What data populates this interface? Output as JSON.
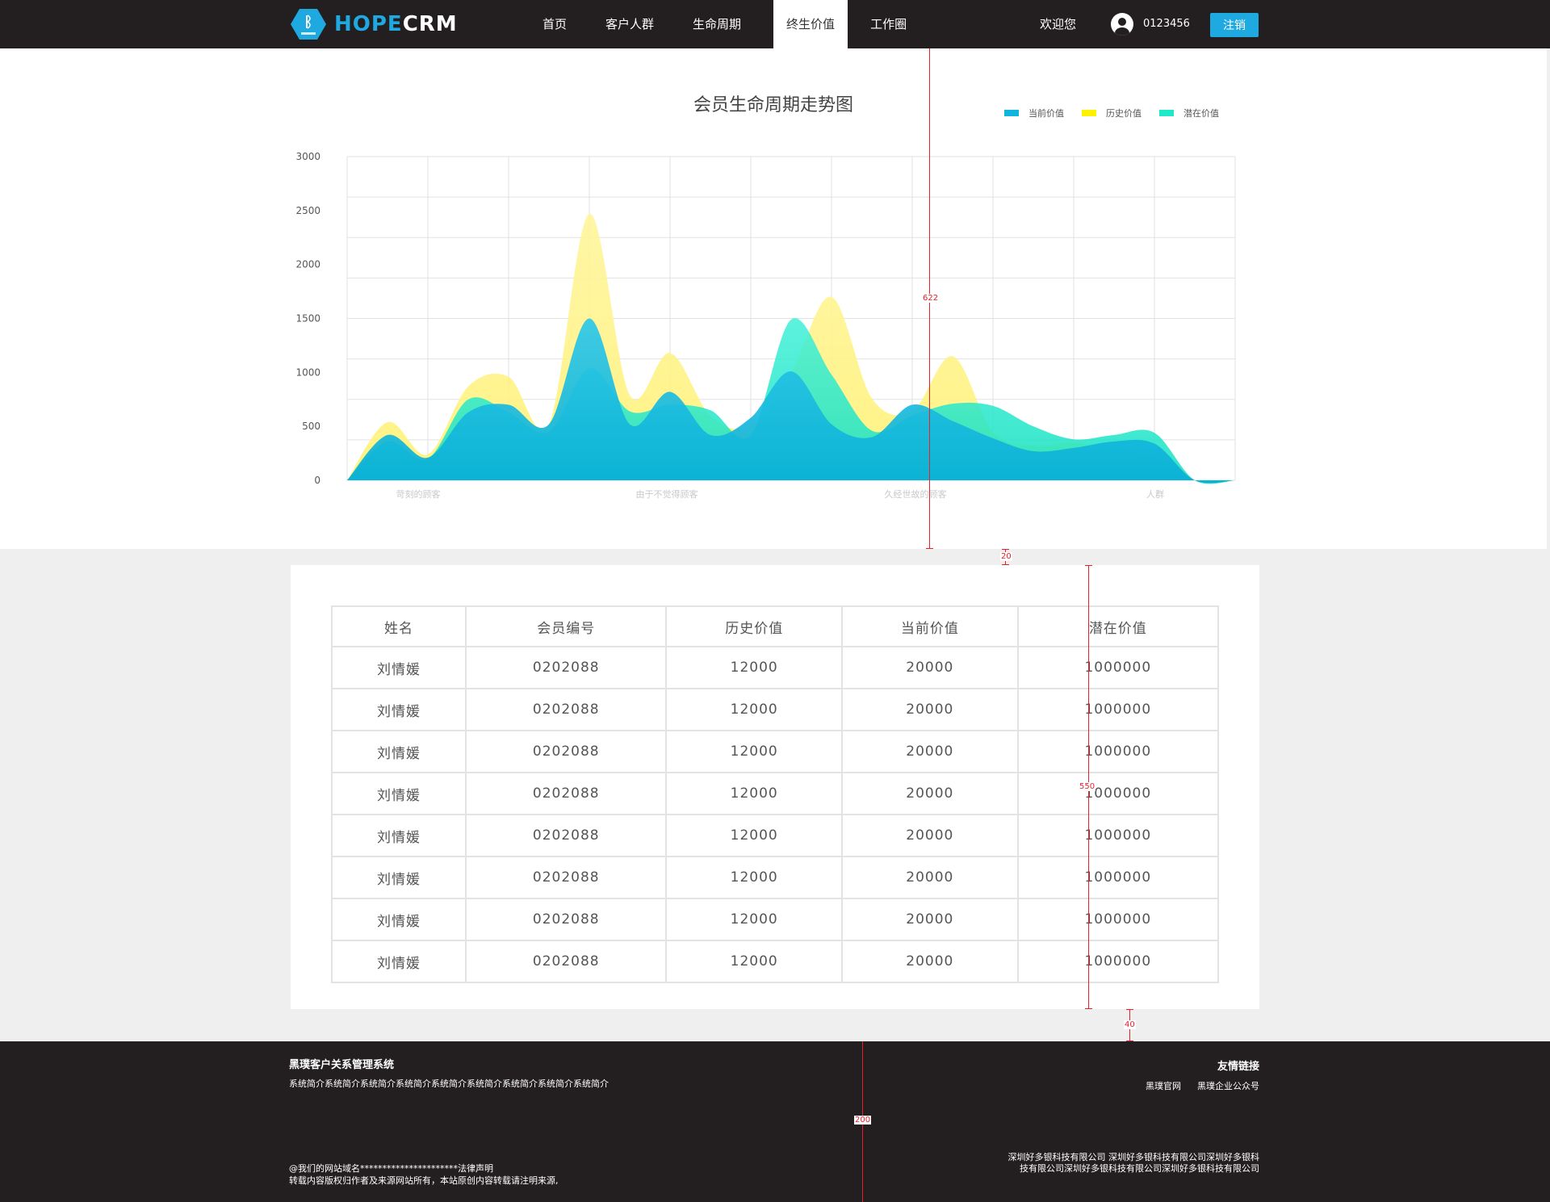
{
  "header": {
    "logo_text_a": "HOPE",
    "logo_text_b": "CRM",
    "nav": [
      {
        "label": "首页"
      },
      {
        "label": "客户人群"
      },
      {
        "label": "生命周期"
      },
      {
        "label": "终生价值",
        "active": true
      },
      {
        "label": "工作圈"
      }
    ],
    "welcome": "欢迎您",
    "user_id": "0123456",
    "logout_label": "注销"
  },
  "chart_data": {
    "type": "area",
    "title": "会员生命周期走势图",
    "categories": [
      "苛刻的顾客",
      "由于不觉得顾客",
      "久经世故的顾客",
      "人群"
    ],
    "ylim": [
      0,
      3000
    ],
    "yticks": [
      0,
      500,
      1000,
      1500,
      2000,
      2500,
      3000
    ],
    "grid": true,
    "legend_position": "top-right",
    "x": [
      0,
      0.5,
      1,
      1.5,
      2,
      2.5,
      3,
      3.5,
      4,
      4.5,
      5,
      5.5,
      6,
      6.5,
      7,
      7.5,
      8,
      8.5,
      9,
      9.5,
      10,
      10.5,
      11
    ],
    "series": [
      {
        "name": "历史价值",
        "color": "#fff176",
        "values": [
          0,
          540,
          240,
          870,
          960,
          520,
          2470,
          790,
          1180,
          600,
          500,
          1000,
          1700,
          760,
          640,
          1150,
          450,
          320,
          350,
          280,
          220,
          0,
          0
        ]
      },
      {
        "name": "潜在价值",
        "color": "#20e8c8",
        "values": [
          0,
          360,
          200,
          750,
          630,
          450,
          1040,
          640,
          700,
          650,
          420,
          1490,
          980,
          460,
          600,
          710,
          690,
          500,
          380,
          420,
          440,
          0,
          0
        ]
      },
      {
        "name": "当前价值",
        "color": "#10b4dd",
        "values": [
          0,
          420,
          210,
          630,
          700,
          520,
          1500,
          520,
          820,
          420,
          580,
          1010,
          520,
          400,
          700,
          550,
          390,
          270,
          300,
          360,
          340,
          0,
          0
        ]
      }
    ]
  },
  "table": {
    "headers": [
      "姓名",
      "会员编号",
      "历史价值",
      "当前价值",
      "潜在价值"
    ],
    "rows": [
      [
        "刘情媛",
        "0202088",
        "12000",
        "20000",
        "1000000"
      ],
      [
        "刘情媛",
        "0202088",
        "12000",
        "20000",
        "1000000"
      ],
      [
        "刘情媛",
        "0202088",
        "12000",
        "20000",
        "1000000"
      ],
      [
        "刘情媛",
        "0202088",
        "12000",
        "20000",
        "1000000"
      ],
      [
        "刘情媛",
        "0202088",
        "12000",
        "20000",
        "1000000"
      ],
      [
        "刘情媛",
        "0202088",
        "12000",
        "20000",
        "1000000"
      ],
      [
        "刘情媛",
        "0202088",
        "12000",
        "20000",
        "1000000"
      ],
      [
        "刘情媛",
        "0202088",
        "12000",
        "20000",
        "1000000"
      ]
    ]
  },
  "footer": {
    "title": "黑璞客户关系管理系统",
    "desc": "系统简介系统简介系统简介系统简介系统简介系统简介系统简介系统简介系统简介",
    "links_title": "友情链接",
    "links": [
      "黑璞官网",
      "黑璞企业公众号"
    ],
    "copyright_1": "@我们的网站域名**********************法律声明",
    "copyright_2": "转载内容版权归作者及来源网站所有，本站原创内容转载请注明来源,",
    "company": "深圳好多银科技有限公司 深圳好多银科技有限公司深圳好多银科技有限公司深圳好多银科技有限公司深圳好多银科技有限公司"
  },
  "annotations": {
    "chart_height": "622",
    "gap_top": "20",
    "table_height": "550",
    "gap_bottom": "40",
    "footer_height": "200"
  },
  "colors": {
    "brand": "#1fa9e1",
    "dark": "#231f20",
    "measure": "#e8202a"
  }
}
